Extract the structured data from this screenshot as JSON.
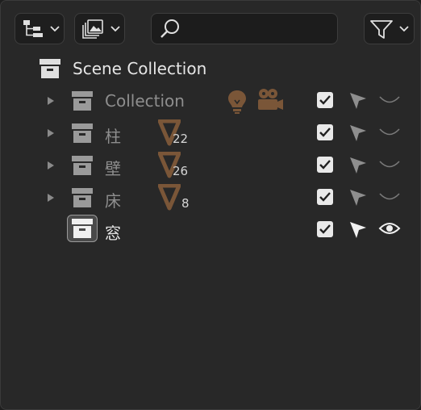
{
  "header": {
    "display_mode_icon": "outliner-tree-icon",
    "filter_icon": "funnel-icon",
    "search": {
      "placeholder": "",
      "value": ""
    }
  },
  "tree": {
    "root": {
      "label": "Scene Collection",
      "icon": "collection-box-icon"
    },
    "items": [
      {
        "label": "Collection",
        "expanded": false,
        "checked": true,
        "selectable": true,
        "visible": false,
        "extra_icons": [
          "light-bulb-icon",
          "camera-icon"
        ]
      },
      {
        "label": "柱",
        "expanded": false,
        "checked": true,
        "selectable": true,
        "visible": false,
        "count": "22"
      },
      {
        "label": "壁",
        "expanded": false,
        "checked": true,
        "selectable": true,
        "visible": false,
        "count": "26"
      },
      {
        "label": "床",
        "expanded": false,
        "checked": true,
        "selectable": true,
        "visible": false,
        "count": "8"
      },
      {
        "label": "窓",
        "active": true,
        "checked": true,
        "selectable": true,
        "visible": true
      }
    ]
  },
  "colors": {
    "panel_bg": "#282828",
    "accent_brown": "#8a5f3e",
    "checkbox": "#e9e9e9"
  }
}
